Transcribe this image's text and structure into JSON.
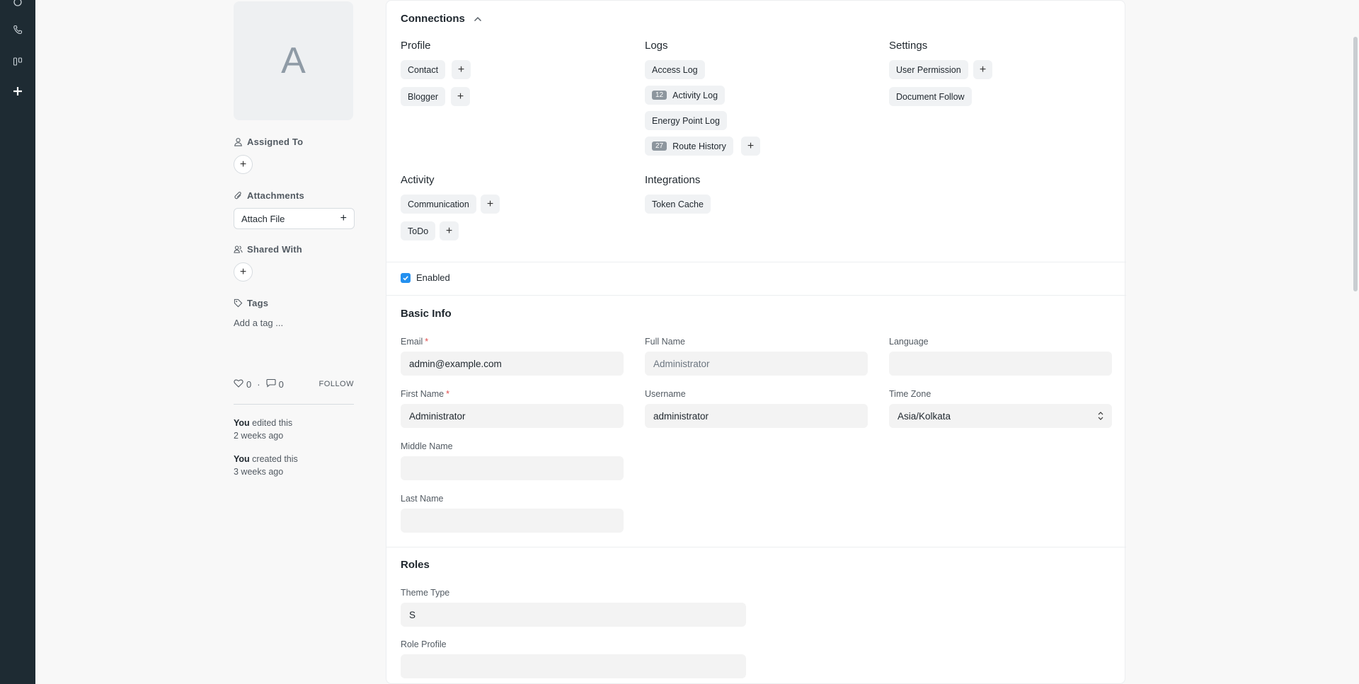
{
  "sidebar": {
    "avatar_letter": "A",
    "assigned_to_label": "Assigned To",
    "attachments_label": "Attachments",
    "attach_file_label": "Attach File",
    "shared_with_label": "Shared With",
    "tags_label": "Tags",
    "add_tag_placeholder": "Add a tag ...",
    "likes": "0",
    "comments": "0",
    "dot": "·",
    "follow_label": "FOLLOW",
    "activity": [
      {
        "actor": "You",
        "action": " edited this",
        "time": "2 weeks ago"
      },
      {
        "actor": "You",
        "action": " created this",
        "time": "3 weeks ago"
      }
    ]
  },
  "connections": {
    "title": "Connections",
    "groups": {
      "profile": {
        "title": "Profile",
        "items": [
          "Contact",
          "Blogger"
        ]
      },
      "logs": {
        "title": "Logs",
        "items": [
          {
            "label": "Access Log",
            "count": ""
          },
          {
            "label": "Activity Log",
            "count": "12"
          },
          {
            "label": "Energy Point Log",
            "count": ""
          },
          {
            "label": "Route History",
            "count": "27"
          }
        ]
      },
      "settings": {
        "title": "Settings",
        "items": [
          "User Permission",
          "Document Follow"
        ]
      },
      "activity": {
        "title": "Activity",
        "items": [
          "Communication",
          "ToDo"
        ]
      },
      "integrations": {
        "title": "Integrations",
        "items": [
          "Token Cache"
        ]
      }
    }
  },
  "enabled": {
    "label": "Enabled",
    "checked": true
  },
  "basic_info": {
    "title": "Basic Info",
    "email": {
      "label": "Email",
      "value": "admin@example.com",
      "required": "*"
    },
    "full_name": {
      "label": "Full Name",
      "value": "Administrator"
    },
    "language": {
      "label": "Language",
      "value": ""
    },
    "first_name": {
      "label": "First Name",
      "value": "Administrator",
      "required": "*"
    },
    "username": {
      "label": "Username",
      "value": "administrator"
    },
    "time_zone": {
      "label": "Time Zone",
      "value": "Asia/Kolkata"
    },
    "middle_name": {
      "label": "Middle Name",
      "value": ""
    },
    "last_name": {
      "label": "Last Name",
      "value": ""
    }
  },
  "roles": {
    "title": "Roles",
    "theme_type": {
      "label": "Theme Type",
      "value": "S"
    },
    "role_profile": {
      "label": "Role Profile",
      "value": ""
    }
  },
  "colors": {
    "rail": "#1e2b33",
    "accent": "#2490ef",
    "required": "#e24c4c"
  }
}
